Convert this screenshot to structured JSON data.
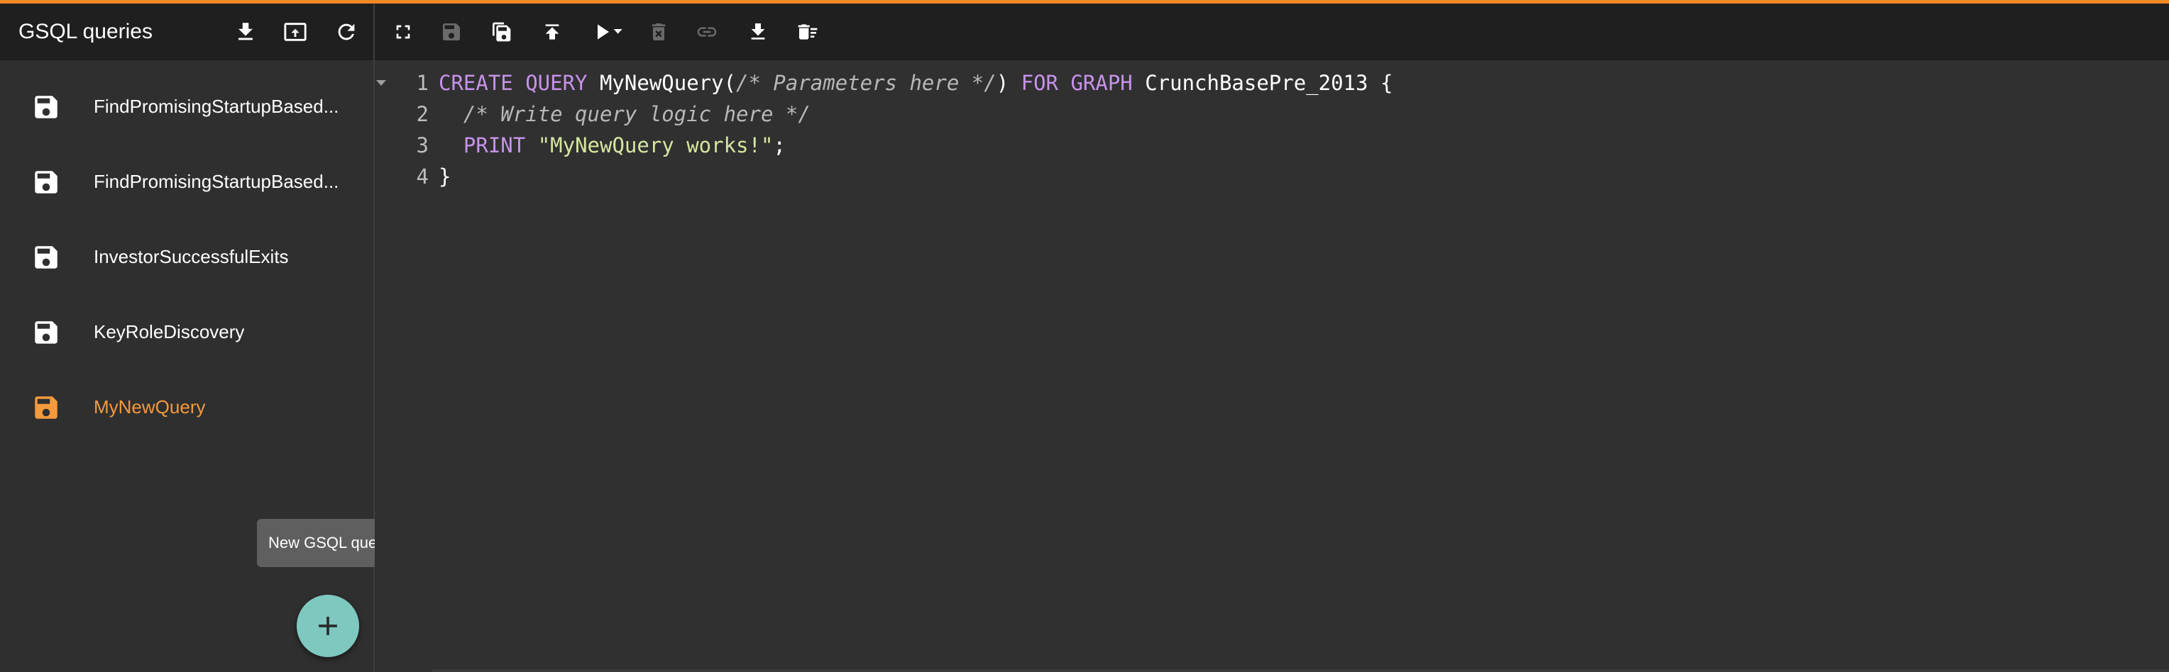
{
  "sidebar": {
    "title": "GSQL queries",
    "header_buttons": [
      {
        "name": "download-all-icon"
      },
      {
        "name": "upload-icon"
      },
      {
        "name": "refresh-icon"
      }
    ],
    "queries": [
      {
        "label": "FindPromisingStartupBased...",
        "active": false
      },
      {
        "label": "FindPromisingStartupBased...",
        "active": false
      },
      {
        "label": "InvestorSuccessfulExits",
        "active": false
      },
      {
        "label": "KeyRoleDiscovery",
        "active": false
      },
      {
        "label": "MyNewQuery",
        "active": true
      }
    ],
    "tooltip": "New GSQL query",
    "accent_color": "#f39a3d",
    "fab_color": "#7ec8c0"
  },
  "toolbar": {
    "buttons": [
      "fullscreen-icon",
      "save-icon",
      "save-as-icon",
      "install-icon",
      "run-icon",
      "delete-icon",
      "link-icon",
      "download-icon",
      "delete-all-icon"
    ]
  },
  "editor": {
    "lines": [
      {
        "num": "1",
        "tokens": [
          {
            "t": "CREATE QUERY",
            "c": "kw"
          },
          {
            "t": " MyNewQuery(",
            "c": ""
          },
          {
            "t": "/* Parameters here */",
            "c": "cm"
          },
          {
            "t": ") ",
            "c": ""
          },
          {
            "t": "FOR GRAPH",
            "c": "kw"
          },
          {
            "t": " CrunchBasePre_2013 {",
            "c": ""
          }
        ]
      },
      {
        "num": "2",
        "tokens": [
          {
            "t": "  ",
            "c": ""
          },
          {
            "t": "/* Write query logic here */",
            "c": "cm"
          }
        ]
      },
      {
        "num": "3",
        "tokens": [
          {
            "t": "  ",
            "c": ""
          },
          {
            "t": "PRINT",
            "c": "kw"
          },
          {
            "t": " ",
            "c": ""
          },
          {
            "t": "\"MyNewQuery works!\"",
            "c": "str"
          },
          {
            "t": ";",
            "c": ""
          }
        ]
      },
      {
        "num": "4",
        "tokens": [
          {
            "t": "}",
            "c": ""
          }
        ]
      }
    ]
  }
}
